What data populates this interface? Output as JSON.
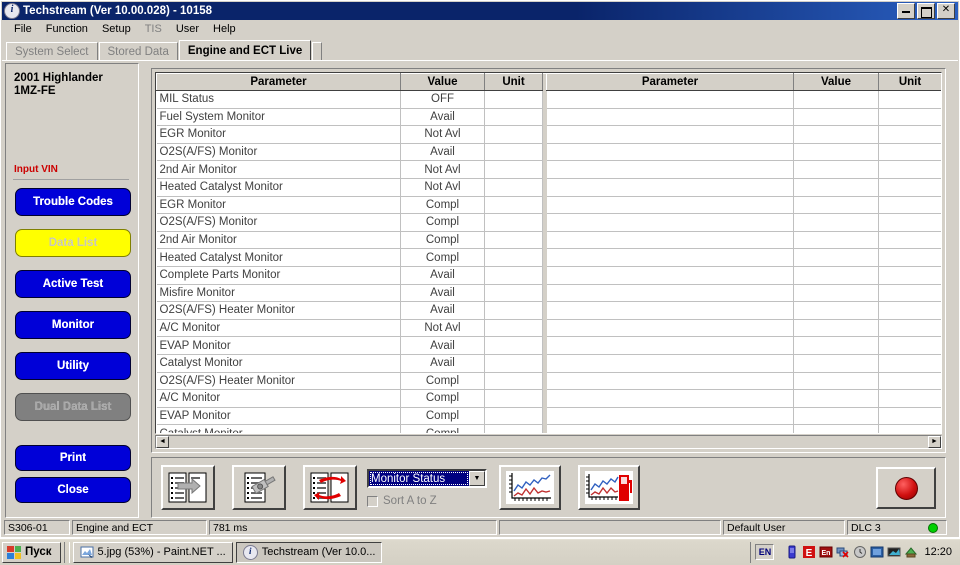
{
  "window": {
    "title": "Techstream (Ver 10.00.028) - 10158",
    "icon": "techstream-logo-icon",
    "buttons": {
      "minimize": "_",
      "maximize": "❐",
      "close": "✕"
    }
  },
  "menubar": {
    "items": [
      {
        "label": "File",
        "disabled": false
      },
      {
        "label": "Function",
        "disabled": false
      },
      {
        "label": "Setup",
        "disabled": false
      },
      {
        "label": "TIS",
        "disabled": true
      },
      {
        "label": "User",
        "disabled": false
      },
      {
        "label": "Help",
        "disabled": false
      }
    ]
  },
  "tabs": [
    {
      "label": "System Select",
      "active": false
    },
    {
      "label": "Stored Data",
      "active": false
    },
    {
      "label": "Engine and ECT Live",
      "active": true
    }
  ],
  "sidebar": {
    "vehicle_line1": "2001 Highlander",
    "vehicle_line2": "1MZ-FE",
    "input_vin_label": "Input VIN",
    "buttons": [
      {
        "label": "Trouble Codes",
        "style": "blue"
      },
      {
        "label": "Data List",
        "style": "yellow"
      },
      {
        "label": "Active Test",
        "style": "blue"
      },
      {
        "label": "Monitor",
        "style": "blue"
      },
      {
        "label": "Utility",
        "style": "blue"
      },
      {
        "label": "Dual Data List",
        "style": "grey"
      },
      {
        "label": "Print",
        "style": "blue"
      },
      {
        "label": "Close",
        "style": "blue"
      }
    ]
  },
  "table": {
    "columns": [
      "Parameter",
      "Value",
      "Unit"
    ],
    "left_rows": [
      {
        "parameter": "MIL Status",
        "value": "OFF",
        "unit": ""
      },
      {
        "parameter": "Fuel System Monitor",
        "value": "Avail",
        "unit": ""
      },
      {
        "parameter": "EGR Monitor",
        "value": "Not Avl",
        "unit": ""
      },
      {
        "parameter": "O2S(A/FS) Monitor",
        "value": "Avail",
        "unit": ""
      },
      {
        "parameter": "2nd Air Monitor",
        "value": "Not Avl",
        "unit": ""
      },
      {
        "parameter": "Heated Catalyst Monitor",
        "value": "Not Avl",
        "unit": ""
      },
      {
        "parameter": "EGR Monitor",
        "value": "Compl",
        "unit": ""
      },
      {
        "parameter": "O2S(A/FS) Monitor",
        "value": "Compl",
        "unit": ""
      },
      {
        "parameter": "2nd Air Monitor",
        "value": "Compl",
        "unit": ""
      },
      {
        "parameter": "Heated Catalyst Monitor",
        "value": "Compl",
        "unit": ""
      },
      {
        "parameter": "Complete Parts Monitor",
        "value": "Avail",
        "unit": ""
      },
      {
        "parameter": "Misfire Monitor",
        "value": "Avail",
        "unit": ""
      },
      {
        "parameter": "O2S(A/FS) Heater Monitor",
        "value": "Avail",
        "unit": ""
      },
      {
        "parameter": "A/C Monitor",
        "value": "Not Avl",
        "unit": ""
      },
      {
        "parameter": "EVAP Monitor",
        "value": "Avail",
        "unit": ""
      },
      {
        "parameter": "Catalyst Monitor",
        "value": "Avail",
        "unit": ""
      },
      {
        "parameter": "O2S(A/FS) Heater Monitor",
        "value": "Compl",
        "unit": ""
      },
      {
        "parameter": "A/C Monitor",
        "value": "Compl",
        "unit": ""
      },
      {
        "parameter": "EVAP Monitor",
        "value": "Compl",
        "unit": ""
      },
      {
        "parameter": "Catalyst Monitor",
        "value": "Compl",
        "unit": ""
      }
    ],
    "right_rows": [
      {
        "parameter": "",
        "value": "",
        "unit": ""
      },
      {
        "parameter": "",
        "value": "",
        "unit": ""
      },
      {
        "parameter": "",
        "value": "",
        "unit": ""
      },
      {
        "parameter": "",
        "value": "",
        "unit": ""
      },
      {
        "parameter": "",
        "value": "",
        "unit": ""
      },
      {
        "parameter": "",
        "value": "",
        "unit": ""
      },
      {
        "parameter": "",
        "value": "",
        "unit": ""
      },
      {
        "parameter": "",
        "value": "",
        "unit": ""
      },
      {
        "parameter": "",
        "value": "",
        "unit": ""
      },
      {
        "parameter": "",
        "value": "",
        "unit": ""
      },
      {
        "parameter": "",
        "value": "",
        "unit": ""
      },
      {
        "parameter": "",
        "value": "",
        "unit": ""
      },
      {
        "parameter": "",
        "value": "",
        "unit": ""
      },
      {
        "parameter": "",
        "value": "",
        "unit": ""
      },
      {
        "parameter": "",
        "value": "",
        "unit": ""
      },
      {
        "parameter": "",
        "value": "",
        "unit": ""
      },
      {
        "parameter": "",
        "value": "",
        "unit": ""
      },
      {
        "parameter": "",
        "value": "",
        "unit": ""
      },
      {
        "parameter": "",
        "value": "",
        "unit": ""
      },
      {
        "parameter": "",
        "value": "",
        "unit": ""
      }
    ],
    "scroll_left_arrow": "◄",
    "scroll_right_arrow": "►"
  },
  "toolbar": {
    "icons": [
      {
        "name": "move-to-right-list-icon"
      },
      {
        "name": "select-list-item-icon"
      },
      {
        "name": "swap-lists-icon"
      },
      {
        "name": "graph-view-icon"
      },
      {
        "name": "graph-snapshot-icon"
      }
    ],
    "dropdown": {
      "value": "Monitor Status",
      "arrow": "▼"
    },
    "checkbox": {
      "label": "Sort A to Z",
      "checked": false
    },
    "record_button": "record-button"
  },
  "statusbar": {
    "code": "S306-01",
    "system": "Engine and ECT",
    "timing": "781 ms",
    "user": "Default User",
    "connection": "DLC 3",
    "connection_ok": true
  },
  "taskbar": {
    "start_label": "Пуск",
    "items": [
      {
        "label": "5.jpg (53%) - Paint.NET ...",
        "icon": "paintnet-icon",
        "active": false
      },
      {
        "label": "Techstream (Ver 10.0...",
        "icon": "techstream-logo-icon",
        "active": true
      }
    ],
    "tray": {
      "language": "EN",
      "icons": [
        "battery-icon",
        "excel-icon",
        "language-bar-icon",
        "network-disconnected-icon",
        "clock-tool-icon",
        "display-icon",
        "monitor-icon",
        "update-icon"
      ],
      "clock": "12:20"
    }
  },
  "colors": {
    "titlebar": "#0a246a",
    "button_blue": "#0000d8",
    "button_yellow": "#ffff00",
    "button_grey": "#808080",
    "vin_red": "#cc0000",
    "face": "#d4d0c8",
    "status_green": "#00d000"
  }
}
